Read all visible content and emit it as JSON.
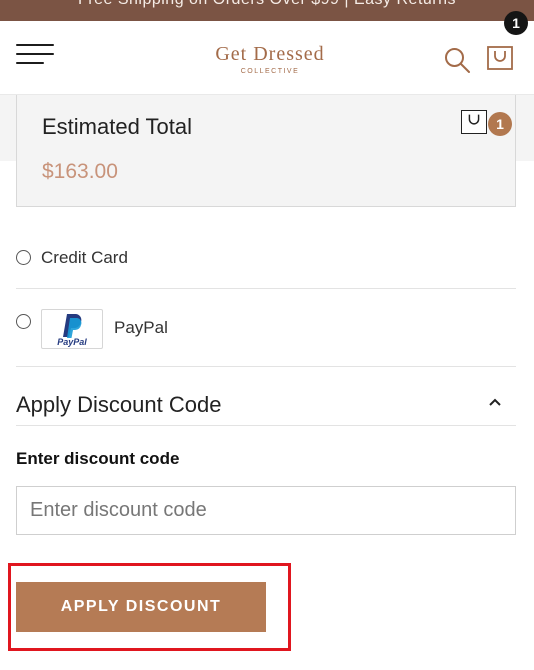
{
  "announcement": {
    "text": "Free Shipping on Orders Over $99 | Easy Returns"
  },
  "header": {
    "menu_icon": "hamburger-menu-icon",
    "logo": {
      "brand": "Get Dressed",
      "sub": "COLLECTIVE"
    },
    "search_icon": "search-icon",
    "cart_icon": "shopping-bag-icon",
    "cart_count": "1"
  },
  "summary": {
    "label": "Estimated Total",
    "value": "$163.00",
    "bag_count": "1"
  },
  "payment": {
    "options": [
      {
        "label": "Credit Card"
      },
      {
        "label": "PayPal",
        "logo_text": "PayPal"
      }
    ]
  },
  "discount": {
    "section_title": "Apply Discount Code",
    "field_label": "Enter discount code",
    "placeholder": "Enter discount code",
    "button_label": "APPLY DISCOUNT"
  },
  "colors": {
    "announcement_bg": "#7b5444",
    "brand": "#a36b49",
    "price": "#c8937a",
    "button": "#b57b55",
    "highlight": "#e0161f"
  }
}
